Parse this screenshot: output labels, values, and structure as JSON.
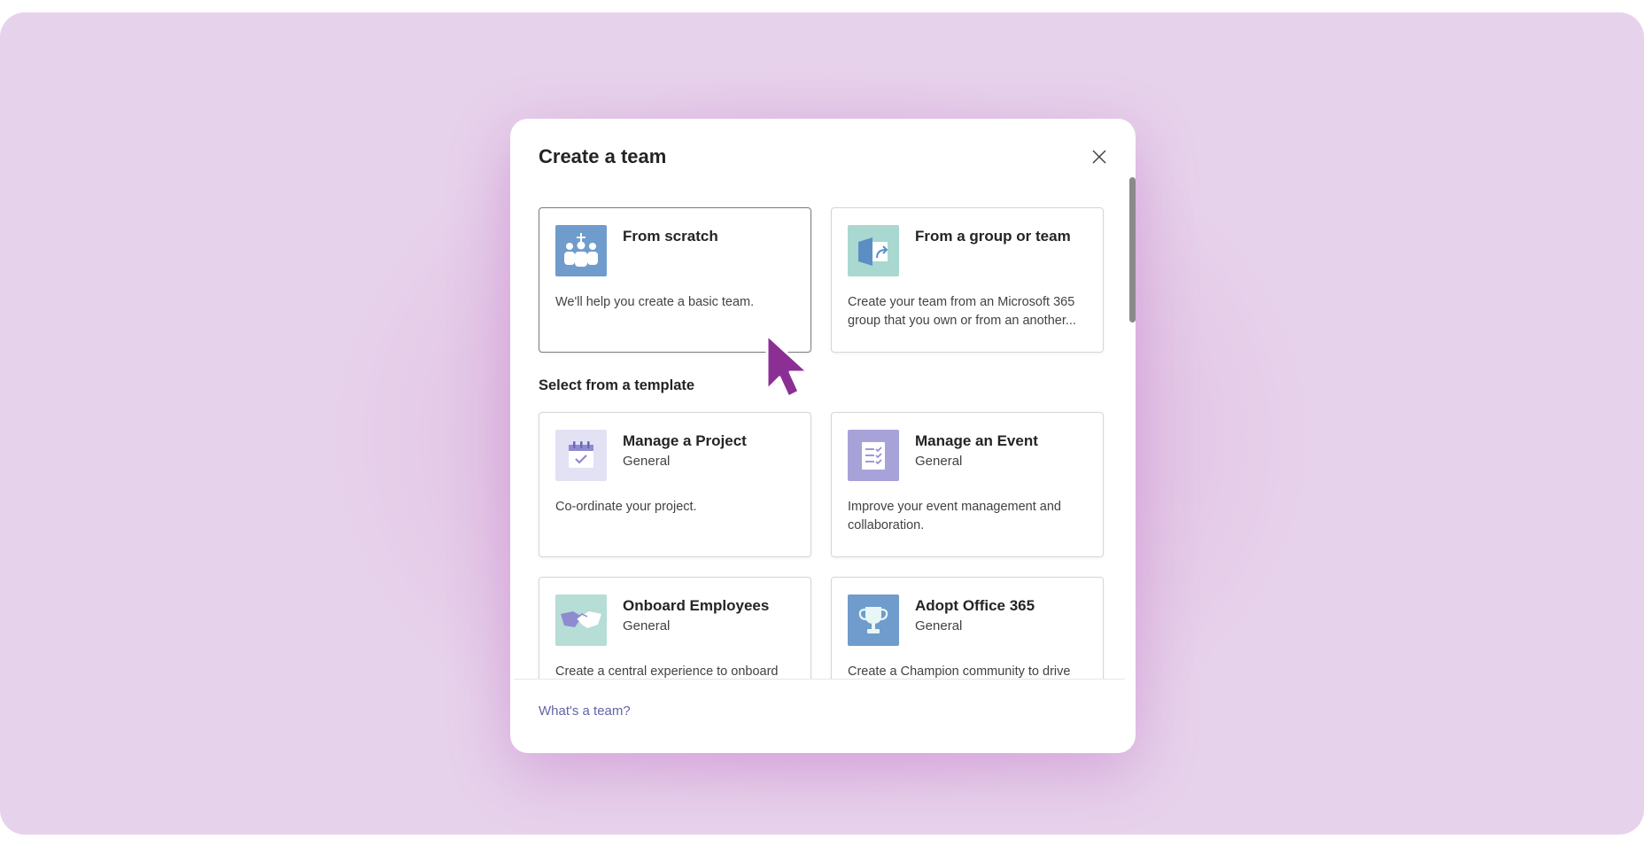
{
  "dialog": {
    "title": "Create a team",
    "close_icon": "close-icon"
  },
  "colors": {
    "background": "#e5c9e8",
    "link": "#6264a7",
    "scratch_icon_bg": "#6f9ccc",
    "group_icon_bg": "#a8d8cf",
    "project_icon_bg": "#e3e1f4",
    "event_icon_bg": "#a7a3d9",
    "onboard_icon_bg": "#b6ddd6",
    "office_icon_bg": "#6f9ccc",
    "cursor": "#8b2f95"
  },
  "start_options": [
    {
      "title": "From scratch",
      "description": "We'll help you create a basic team.",
      "icon": "team-plus-icon"
    },
    {
      "title": "From a group or team",
      "description": "Create your team from an Microsoft 365 group that you own or from an another...",
      "icon": "group-arrow-icon"
    }
  ],
  "templates_section": {
    "heading": "Select from a template",
    "items": [
      {
        "title": "Manage a Project",
        "subtitle": "General",
        "description": "Co-ordinate your project.",
        "icon": "calendar-check-icon"
      },
      {
        "title": "Manage an Event",
        "subtitle": "General",
        "description": "Improve your event management and collaboration.",
        "icon": "checklist-icon"
      },
      {
        "title": "Onboard Employees",
        "subtitle": "General",
        "description": "Create a central experience to onboard",
        "icon": "handshake-icon"
      },
      {
        "title": "Adopt Office 365",
        "subtitle": "General",
        "description": "Create a Champion community to drive",
        "icon": "trophy-icon"
      }
    ]
  },
  "footer": {
    "link_label": "What's a team?"
  }
}
